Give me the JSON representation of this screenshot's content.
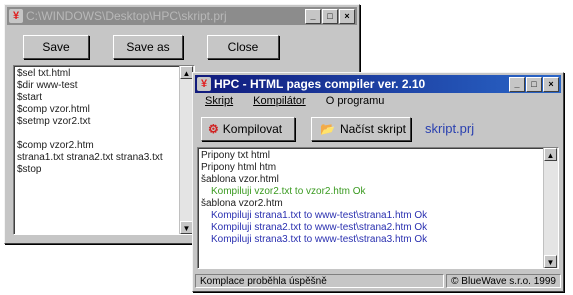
{
  "back_window": {
    "title": "C:\\WINDOWS\\Desktop\\HPC\\skript.prj",
    "buttons": {
      "save": "Save",
      "save_as": "Save as",
      "close": "Close"
    },
    "lines": [
      "$sel txt.html",
      "$dir www-test",
      "$start",
      "$comp vzor.html",
      "$setmp vzor2.txt",
      "",
      "$comp vzor2.htm",
      "strana1.txt strana2.txt strana3.txt",
      "$stop"
    ]
  },
  "front_window": {
    "title": "HPC - HTML pages compiler ver. 2.10",
    "menu": {
      "skript": "Skript",
      "kompilator": "Kompilátor",
      "o_programu": "O programu"
    },
    "buttons": {
      "kompilovat": "Kompilovat",
      "nacist_skript": "Načíst skript"
    },
    "script_name": "skript.prj",
    "output": [
      {
        "text": "Pripony txt html",
        "style": "plain"
      },
      {
        "text": "Pripony html htm",
        "style": "plain"
      },
      {
        "text": "šablona vzor.html",
        "style": "plain"
      },
      {
        "text": "Kompiluji vzor2.txt to vzor2.htm   Ok",
        "style": "green"
      },
      {
        "text": "šablona vzor2.htm",
        "style": "plain"
      },
      {
        "text": "Kompiluji strana1.txt to www-test\\strana1.htm   Ok",
        "style": "blue"
      },
      {
        "text": "Kompiluji strana2.txt to www-test\\strana2.htm   Ok",
        "style": "blue"
      },
      {
        "text": "Kompiluji strana3.txt to www-test\\strana3.htm   Ok",
        "style": "blue"
      }
    ],
    "status": {
      "message": "Komplace proběhla úspěšně",
      "copyright": "© BlueWave s.r.o. 1999"
    }
  }
}
